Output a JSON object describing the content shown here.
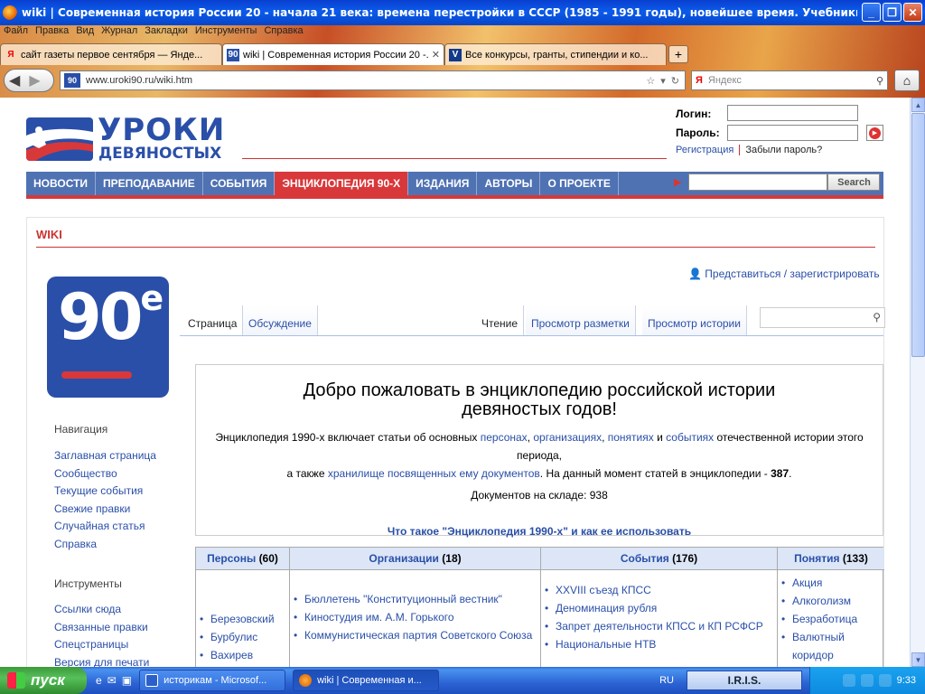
{
  "window": {
    "title": "wiki | Современная история России 20 - начала 21 века: времена перестройки в СССР (1985 - 1991 годы), новейшее время. Учебники, мето..."
  },
  "menubar": [
    "Файл",
    "Правка",
    "Вид",
    "Журнал",
    "Закладки",
    "Инструменты",
    "Справка"
  ],
  "tabs": [
    {
      "label": "сайт газеты первое сентября — Янде...",
      "favicon": "Я",
      "active": false
    },
    {
      "label": "wiki | Современная история России 20 -...",
      "favicon": "90",
      "active": true
    },
    {
      "label": "Все конкурсы, гранты, стипендии и ко...",
      "favicon": "V",
      "active": false
    }
  ],
  "addressbar": {
    "url": "www.uroki90.ru/wiki.htm",
    "site_icon": "90"
  },
  "yandex_search": {
    "placeholder": "Яндекс",
    "logo": "Я"
  },
  "site": {
    "logo_line1": "УРОКИ",
    "logo_line2": "ДЕВЯНОСТЫХ",
    "login_label": "Логин:",
    "password_label": "Пароль:",
    "register_link": "Регистрация",
    "forgot_link": "Забыли пароль?",
    "nav": [
      "НОВОСТИ",
      "ПРЕПОДАВАНИЕ",
      "СОБЫТИЯ",
      "ЭНЦИКЛОПЕДИЯ 90-Х",
      "ИЗДАНИЯ",
      "АВТОРЫ",
      "О ПРОЕКТЕ"
    ],
    "nav_active_index": 3,
    "search_button": "Search",
    "colors": {
      "brand_blue": "#2a4fa8",
      "accent_red": "#d8383a"
    }
  },
  "wiki": {
    "header": "WIKI",
    "personal_link": "Представиться / зарегистрировать",
    "logo_num": "90",
    "logo_sup": "е",
    "navigation_heading": "Навигация",
    "navigation": [
      "Заглавная страница",
      "Сообщество",
      "Текущие события",
      "Свежие правки",
      "Случайная статья",
      "Справка"
    ],
    "tools_heading": "Инструменты",
    "tools": [
      "Ссылки сюда",
      "Связанные правки",
      "Спецстраницы",
      "Версия для печати"
    ],
    "tabs_left": [
      "Страница",
      "Обсуждение"
    ],
    "tabs_right": [
      "Чтение",
      "Просмотр разметки",
      "Просмотр истории"
    ],
    "welcome_title": "Добро пожаловать в энциклопедию российской истории девяностых годов!",
    "intro_prefix": "Энциклопедия 1990-х включает статьи об основных",
    "intro_links": [
      "персонах",
      "организациях",
      "понятиях",
      "событиях"
    ],
    "intro_and": "и",
    "intro_suffix": "отечественной истории этого периода,",
    "also_prefix": "а также",
    "also_link": "хранилище посвященных ему документов",
    "also_suffix": ". На данный момент статей в энциклопедии -",
    "article_count": "387",
    "docs_text": "Документов на складе: 938",
    "what_is_link": "Что такое \"Энциклопедия 1990-х\" и как ее использовать",
    "categories": [
      {
        "name": "Персоны",
        "count": "(60)",
        "items": [
          "Березовский",
          "Бурбулис",
          "Вахирев"
        ]
      },
      {
        "name": "Организации",
        "count": "(18)",
        "items": [
          "Бюллетень \"Конституционный вестник\"",
          "Киностудия им. А.М. Горького",
          "Коммунистическая партия Советского Союза"
        ]
      },
      {
        "name": "События",
        "count": "(176)",
        "items": [
          "XXVIII съезд КПСС",
          "Деноминация рубля",
          "Запрет деятельности КПСС и КП РСФСР",
          "Национальные НТВ"
        ]
      },
      {
        "name": "Понятия",
        "count": "(133)",
        "items": [
          "Акция",
          "Алкоголизм",
          "Безработица",
          "Валютный коридор"
        ]
      }
    ]
  },
  "taskbar": {
    "start": "пуск",
    "tasks": [
      {
        "label": "историкам - Microsof...",
        "active": false
      },
      {
        "label": "wiki | Современная и...",
        "active": true
      }
    ],
    "lang": "RU",
    "iris": "I.R.I.S.",
    "clock": "9:33"
  }
}
